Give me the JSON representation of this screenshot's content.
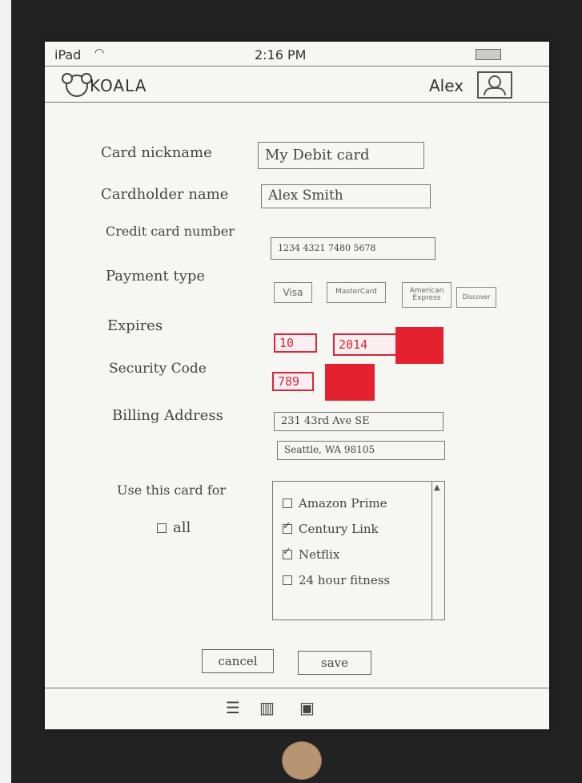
{
  "status_bar": {
    "carrier": "iPad",
    "time": "2:16 PM"
  },
  "header": {
    "brand": "KOALA",
    "username": "Alex"
  },
  "form": {
    "card_nickname": {
      "label": "Card nickname",
      "value": "My Debit card"
    },
    "cardholder_name": {
      "label": "Cardholder name",
      "value": "Alex Smith"
    },
    "card_number": {
      "label": "Credit card number",
      "value": "1234 4321 7480 5678"
    },
    "payment_type": {
      "label": "Payment type",
      "options": [
        "Visa",
        "MasterCard",
        "American Express",
        "Discover"
      ]
    },
    "expires": {
      "label": "Expires",
      "month": "10",
      "year": "2014"
    },
    "security_code": {
      "label": "Security Code",
      "value": "789"
    },
    "billing_address": {
      "label": "Billing Address",
      "line1": "231 43rd Ave SE",
      "line2": "Seattle, WA 98105"
    },
    "use_card_for": {
      "label": "Use this card for",
      "all_label": "all",
      "items": [
        {
          "label": "Amazon Prime",
          "checked": false
        },
        {
          "label": "Century Link",
          "checked": true
        },
        {
          "label": "Netflix",
          "checked": true
        },
        {
          "label": "24 hour fitness",
          "checked": false
        }
      ]
    }
  },
  "actions": {
    "cancel": "cancel",
    "save": "save"
  },
  "colors": {
    "accent_red": "#e4212e",
    "paper": "#f6f6f2"
  }
}
